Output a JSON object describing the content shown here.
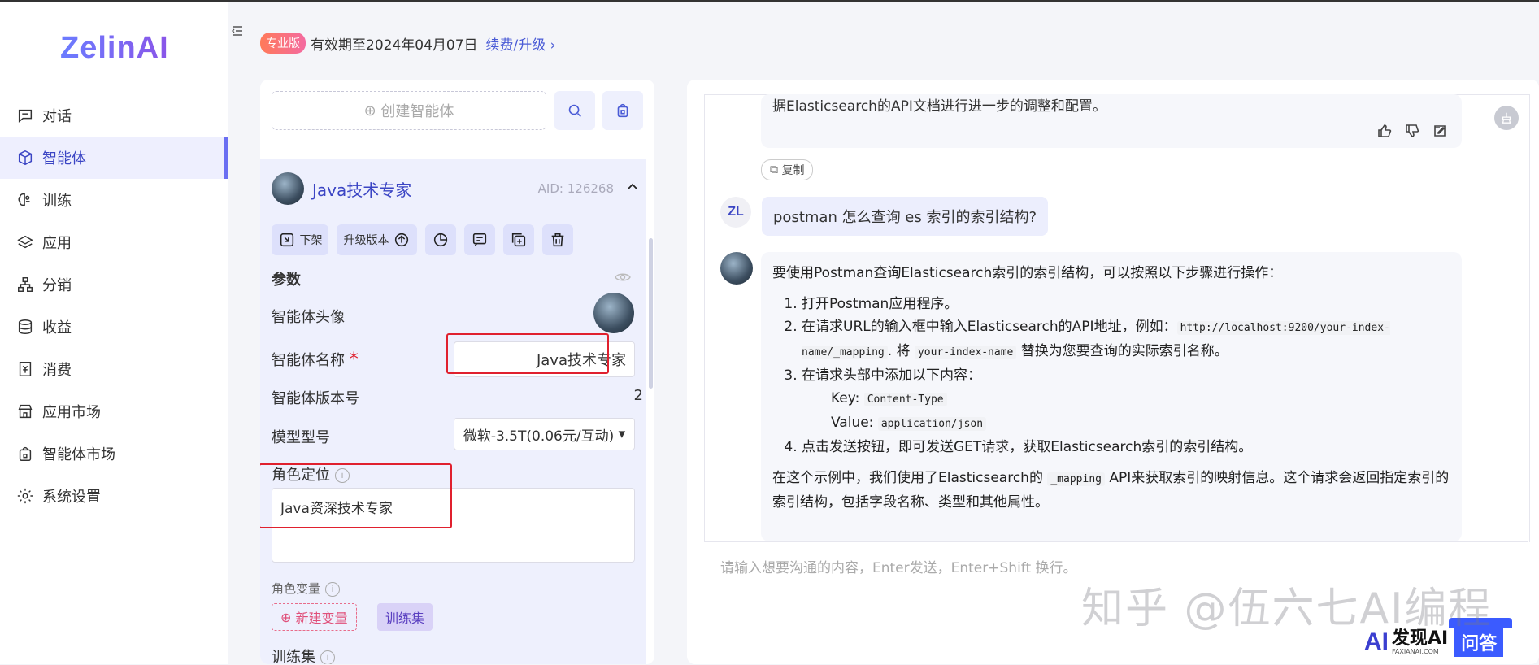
{
  "app": {
    "logo": "ZelinAI"
  },
  "sidebar": {
    "items": [
      {
        "label": "对话",
        "icon": "chat-icon"
      },
      {
        "label": "智能体",
        "icon": "cube-icon",
        "active": true
      },
      {
        "label": "训练",
        "icon": "brain-icon"
      },
      {
        "label": "应用",
        "icon": "layers-icon"
      },
      {
        "label": "分销",
        "icon": "hierarchy-icon"
      },
      {
        "label": "收益",
        "icon": "coins-icon"
      },
      {
        "label": "消费",
        "icon": "receipt-icon"
      },
      {
        "label": "应用市场",
        "icon": "store-icon"
      },
      {
        "label": "智能体市场",
        "icon": "bag-icon"
      },
      {
        "label": "系统设置",
        "icon": "gear-icon"
      }
    ]
  },
  "header": {
    "badge": "专业版",
    "validity": "有效期至2024年04月07日",
    "renew": "续费/升级"
  },
  "agent_panel": {
    "create_label": "创建智能体",
    "agent_name": "Java技术专家",
    "aid": "AID: 126268",
    "tools": {
      "unpublish": "下架",
      "upgrade": "升级版本"
    },
    "params_title": "参数",
    "avatar_label": "智能体头像",
    "name_label": "智能体名称",
    "name_value": "Java技术专家",
    "version_label": "智能体版本号",
    "version_value": "2",
    "model_label": "模型型号",
    "model_value": "微软-3.5T(0.06元/互动)",
    "role_label": "角色定位",
    "role_value": "Java资深技术专家",
    "var_label": "角色变量",
    "new_var": "新建变量",
    "train_set_btn": "训练集",
    "train_set_label": "训练集"
  },
  "chat": {
    "prev_tail": "据Elasticsearch的API文档进行进一步的调整和配置。",
    "copy_label": "复制",
    "user_avatar": "ZL",
    "user_message": "postman 怎么查询 es 索引的索引结构?",
    "answer_intro": "要使用Postman查询Elasticsearch索引的索引结构，可以按照以下步骤进行操作：",
    "step1": "打开Postman应用程序。",
    "step2_a": "在请求URL的输入框中输入Elasticsearch的API地址，例如：",
    "step2_code": "http://localhost:9200/your-index-name/_mapping",
    "step2_b": ". 将",
    "step2_code2": "your-index-name",
    "step2_c": "替换为您要查询的实际索引名称。",
    "step3": "在请求头部中添加以下内容：",
    "key_label": "Key:",
    "key_code": "Content-Type",
    "value_label": "Value:",
    "value_code": "application/json",
    "step4": "点击发送按钮，即可发送GET请求，获取Elasticsearch索引的索引结构。",
    "summary_a": "在这个示例中，我们使用了Elasticsearch的",
    "summary_code": "_mapping",
    "summary_b": "API来获取索引的映射信息。这个请求会返回指定索引的索引结构，包括字段名称、类型和其他属性。",
    "input_placeholder": "请输入想要沟通的内容，Enter发送，Enter+Shift 换行。"
  },
  "watermark": "知乎 @伍六七AI编程",
  "brand": {
    "name": "发现AI",
    "sub": "FAXIANAI.COM",
    "ask": "问答"
  },
  "colors": {
    "accent": "#3b45c4",
    "highlight_box": "#e0202e",
    "badge": "#ff7a59"
  }
}
